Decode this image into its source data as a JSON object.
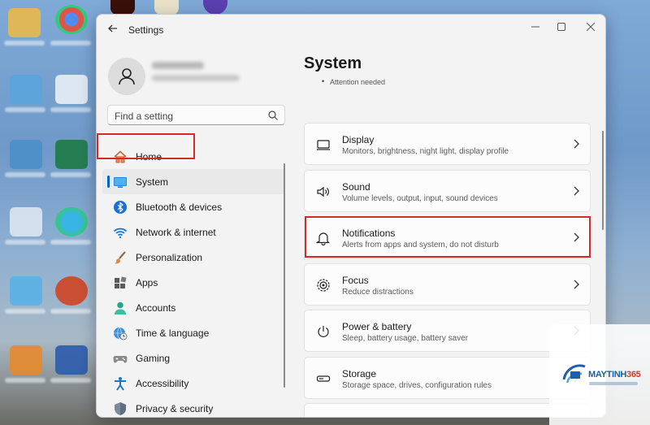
{
  "window": {
    "title": "Settings",
    "controls": {
      "minimize": "—",
      "maximize": "☐",
      "close": "✕"
    }
  },
  "nav": {
    "search_placeholder": "Find a setting",
    "items": [
      {
        "label": "Home",
        "icon": "home-icon",
        "active": false
      },
      {
        "label": "System",
        "icon": "monitor-icon",
        "active": true
      },
      {
        "label": "Bluetooth & devices",
        "icon": "bluetooth-icon",
        "active": false
      },
      {
        "label": "Network & internet",
        "icon": "wifi-icon",
        "active": false
      },
      {
        "label": "Personalization",
        "icon": "paintbrush-icon",
        "active": false
      },
      {
        "label": "Apps",
        "icon": "apps-icon",
        "active": false
      },
      {
        "label": "Accounts",
        "icon": "person-icon",
        "active": false
      },
      {
        "label": "Time & language",
        "icon": "globe-clock-icon",
        "active": false
      },
      {
        "label": "Gaming",
        "icon": "gamepad-icon",
        "active": false
      },
      {
        "label": "Accessibility",
        "icon": "accessibility-icon",
        "active": false
      },
      {
        "label": "Privacy & security",
        "icon": "shield-icon",
        "active": false
      }
    ]
  },
  "main": {
    "title": "System",
    "attention": "Attention needed",
    "cards": [
      {
        "title": "Display",
        "subtitle": "Monitors, brightness, night light, display profile",
        "icon": "display-icon"
      },
      {
        "title": "Sound",
        "subtitle": "Volume levels, output, input, sound devices",
        "icon": "speaker-icon"
      },
      {
        "title": "Notifications",
        "subtitle": "Alerts from apps and system, do not disturb",
        "icon": "bell-icon"
      },
      {
        "title": "Focus",
        "subtitle": "Reduce distractions",
        "icon": "focus-icon"
      },
      {
        "title": "Power & battery",
        "subtitle": "Sleep, battery usage, battery saver",
        "icon": "power-icon"
      },
      {
        "title": "Storage",
        "subtitle": "Storage space, drives, configuration rules",
        "icon": "storage-icon"
      }
    ]
  },
  "watermark": {
    "brand_main": "MAYTINH",
    "brand_num": "365"
  },
  "colors": {
    "accent": "#0067c0",
    "highlight": "#d42a2a"
  }
}
